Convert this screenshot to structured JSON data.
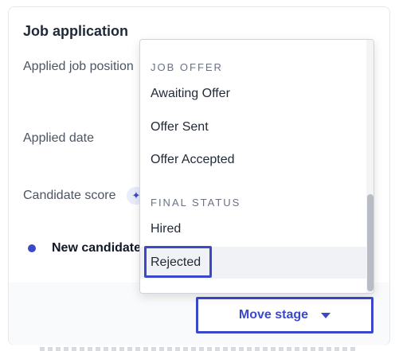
{
  "card": {
    "title": "Job application",
    "fields": {
      "applied_position_label": "Applied job position",
      "applied_date_label": "Applied date",
      "candidate_score_label": "Candidate score"
    },
    "status": "New candidate"
  },
  "ai_badge_icon": "sparkle-icon",
  "dropdown": {
    "sections": [
      {
        "header": "JOB OFFER",
        "items": [
          "Awaiting Offer",
          "Offer Sent",
          "Offer Accepted"
        ]
      },
      {
        "header": "FINAL STATUS",
        "items": [
          "Hired",
          "Rejected"
        ]
      }
    ],
    "highlighted_item": "Rejected"
  },
  "action": {
    "move_stage_label": "Move stage",
    "caret_icon": "chevron-down-icon"
  },
  "colors": {
    "accent": "#3b49c9",
    "hover_bg": "#f0f2f5"
  }
}
